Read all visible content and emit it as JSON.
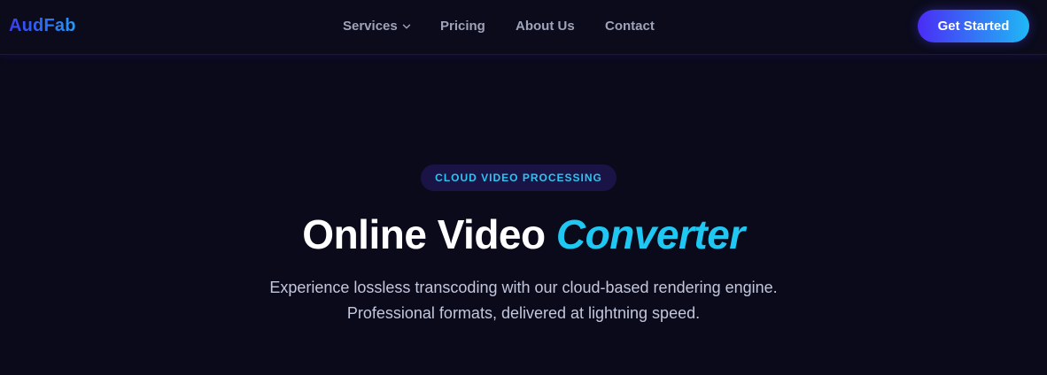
{
  "nav": {
    "logo": "AudFab",
    "links": [
      {
        "label": "Services",
        "has_dropdown": true
      },
      {
        "label": "Pricing"
      },
      {
        "label": "About Us"
      },
      {
        "label": "Contact"
      }
    ],
    "cta_label": "Get Started"
  },
  "hero": {
    "badge": "CLOUD VIDEO PROCESSING",
    "title_main": "Online Video",
    "title_accent": "Converter",
    "subtitle_line1": "Experience lossless transcoding with our cloud-based rendering engine.",
    "subtitle_line2": "Professional formats, delivered at lightning speed."
  },
  "colors": {
    "background": "#0a0a1a",
    "accent_cyan": "#1ec8f2",
    "cta_gradient_start": "#4a2cf5",
    "cta_gradient_end": "#1fb9f5",
    "badge_bg": "#1a1446",
    "nav_text": "#9fa3b8"
  },
  "icons": {
    "services_dropdown": "chevron-down-icon"
  }
}
